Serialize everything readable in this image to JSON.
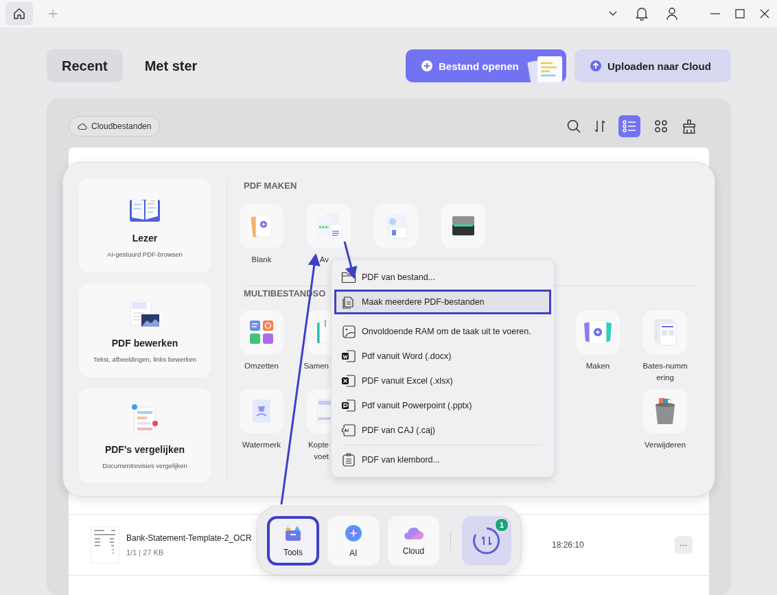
{
  "titlebar": {
    "home_selected": true
  },
  "tabs": [
    {
      "label": "Recent",
      "selected": true
    },
    {
      "label": "Met ster",
      "selected": false
    }
  ],
  "actions": [
    {
      "label": "Bestand openen",
      "kind": "primary"
    },
    {
      "label": "Uploaden naar Cloud",
      "kind": "secondary"
    }
  ],
  "toolbar": {
    "cloud_button": "Cloudbestanden",
    "view_modes": [
      {
        "kind": "list",
        "selected": true
      },
      {
        "kind": "grid",
        "selected": false
      }
    ]
  },
  "files": [
    {
      "name": "Bank-Statement-Template-2_OCR",
      "meta": "1/1 | 27 KB",
      "time": "18:26:10",
      "more": "···"
    }
  ],
  "tools_panel": {
    "features": [
      {
        "kind": "reader",
        "title": "Lezer",
        "subtitle": "AI-gestuurd PDF-browsen"
      },
      {
        "kind": "edit",
        "title": "PDF bewerken",
        "subtitle": "Tekst, afbeeldingen, links bewerken"
      },
      {
        "kind": "compare",
        "title": "PDF's vergelijken",
        "subtitle": "Documentrevisies vergelijken"
      }
    ],
    "create": {
      "heading": "PDF MAKEN",
      "tiles": [
        {
          "kind": "blank",
          "label": "Blank",
          "cut": false
        },
        {
          "kind": "convert",
          "label": "Av",
          "cut": true
        },
        {
          "kind": "image"
        },
        {
          "kind": "scanner"
        }
      ]
    },
    "multi": {
      "heading": "MULTIBESTANDSO",
      "rows": [
        {
          "left": [
            {
              "kind": "convert-grid",
              "label": "Omzetten",
              "cut": false
            },
            {
              "kind": "merge",
              "label": "Samen",
              "cut": true
            }
          ],
          "right": [
            {
              "kind": "make",
              "label": "Maken",
              "cut": false
            },
            {
              "kind": "bates",
              "label": "Bates-nummering",
              "cut": false
            }
          ]
        },
        {
          "left": [
            {
              "kind": "watermark",
              "label": "Watermerk",
              "cut": false
            },
            {
              "kind": "header",
              "label": "Kopte voet",
              "cut": true
            }
          ],
          "right": [
            {
              "kind": "trash",
              "label": "Verwijderen",
              "cut": false
            }
          ]
        }
      ]
    }
  },
  "menu": {
    "groups": [
      {
        "items": [
          {
            "kind": "folder",
            "label": "PDF van bestand...",
            "selected": false
          },
          {
            "kind": "multi",
            "label": "Maak meerdere PDF-bestanden",
            "selected": true
          }
        ]
      },
      {
        "items": [
          {
            "kind": "image",
            "label": "Onvoldoende RAM om de taak uit te voeren.",
            "selected": false
          },
          {
            "kind": "word",
            "label": "Pdf vanuit Word (.docx)",
            "selected": false
          },
          {
            "kind": "excel",
            "label": "PDF vanuit Excel (.xlsx)",
            "selected": false
          },
          {
            "kind": "ppt",
            "label": "Pdf vanuit Powerpoint (.pptx)",
            "selected": false
          },
          {
            "kind": "caj",
            "label": "PDF van CAJ (.caj)",
            "selected": false
          }
        ]
      },
      {
        "items": [
          {
            "kind": "clipboard",
            "label": "PDF van klembord...",
            "selected": false
          }
        ]
      }
    ]
  },
  "dock": {
    "items": [
      {
        "kind": "tools",
        "label": "Tools",
        "selected": true
      },
      {
        "kind": "ai",
        "label": "AI",
        "selected": false
      },
      {
        "kind": "cloud",
        "label": "Cloud",
        "selected": false
      }
    ],
    "sync": {
      "badge": "1"
    }
  }
}
